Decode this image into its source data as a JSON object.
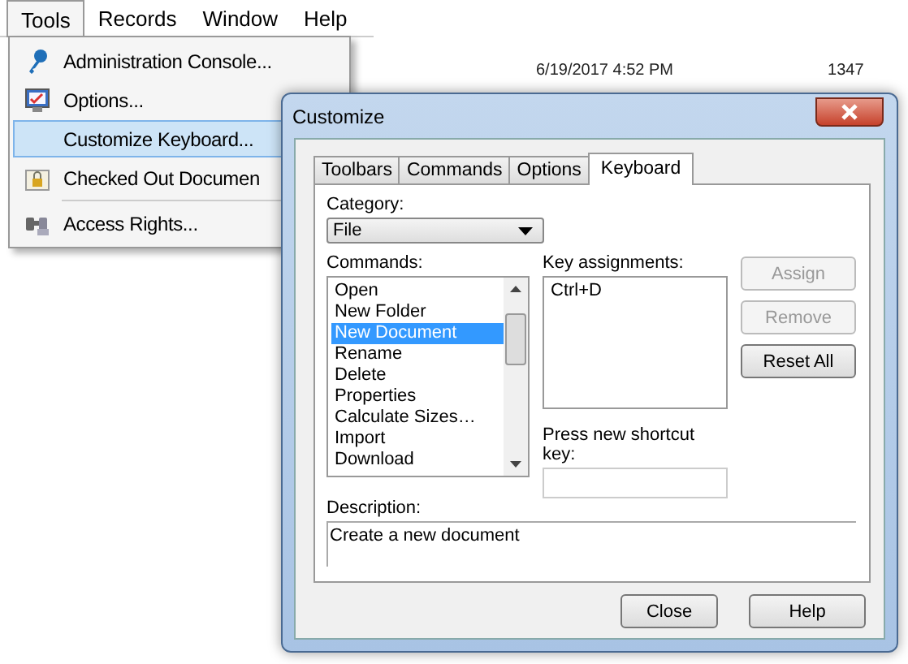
{
  "background": {
    "date": "6/19/2017 4:52 PM",
    "number": "1347"
  },
  "menubar": [
    {
      "label": "Tools",
      "selected": true
    },
    {
      "label": "Records",
      "selected": false
    },
    {
      "label": "Window",
      "selected": false
    },
    {
      "label": "Help",
      "selected": false
    }
  ],
  "menu": [
    {
      "label": "Administration Console...",
      "kind": "key",
      "selected": false,
      "separator_before": false
    },
    {
      "label": "Options...",
      "kind": "monitor",
      "selected": false,
      "separator_before": false
    },
    {
      "label": "Customize Keyboard...",
      "kind": "plain",
      "selected": true,
      "separator_before": false
    },
    {
      "label": "Checked Out Documen",
      "kind": "lock",
      "selected": false,
      "separator_before": false
    },
    {
      "label": "Access Rights...",
      "kind": "binoculars",
      "selected": false,
      "separator_before": true
    }
  ],
  "dialog": {
    "title": "Customize",
    "tabs": [
      {
        "label": "Toolbars",
        "selected": false
      },
      {
        "label": "Commands",
        "selected": false
      },
      {
        "label": "Options",
        "selected": false
      },
      {
        "label": "Keyboard",
        "selected": true
      }
    ],
    "category_label": "Category:",
    "category_value": "File",
    "commands_label": "Commands:",
    "commands": [
      {
        "label": "Open",
        "selected": false
      },
      {
        "label": "New Folder",
        "selected": false
      },
      {
        "label": "New Document",
        "selected": true
      },
      {
        "label": "Rename",
        "selected": false
      },
      {
        "label": "Delete",
        "selected": false
      },
      {
        "label": "Properties",
        "selected": false
      },
      {
        "label": "Calculate Sizes…",
        "selected": false
      },
      {
        "label": "Import",
        "selected": false
      },
      {
        "label": "Download",
        "selected": false
      }
    ],
    "key_assignments_label": "Key assignments:",
    "key_assignments": [
      "Ctrl+D"
    ],
    "side_buttons": [
      {
        "label": "Assign",
        "disabled": true
      },
      {
        "label": "Remove",
        "disabled": true
      },
      {
        "label": "Reset All",
        "disabled": false
      }
    ],
    "shortcut_label": "Press new shortcut key:",
    "description_label": "Description:",
    "description": "Create a new document",
    "buttons": [
      "Close",
      "Help"
    ]
  }
}
